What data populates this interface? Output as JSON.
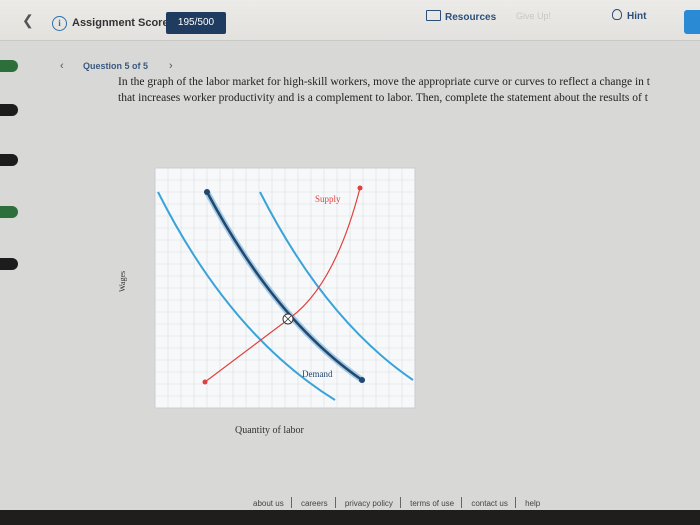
{
  "header": {
    "assignment_score_label": "Assignment Score:",
    "score_value": "195/500",
    "resources_label": "Resources",
    "give_up_label": "Give Up!",
    "hint_label": "Hint"
  },
  "question_nav": {
    "label": "Question 5 of 5"
  },
  "prompt": {
    "line1": "In the graph of the labor market for high-skill workers, move the appropriate curve or curves to reflect a change in t",
    "line2": "that increases worker productivity and is a complement to labor. Then, complete the statement about the results of t"
  },
  "graph": {
    "y_axis_label": "Wages",
    "x_axis_label": "Quantity of labor",
    "supply_label": "Supply",
    "demand_label": "Demand",
    "colors": {
      "supply": "#e0413f",
      "demand_original": "#2e6a9e",
      "demand_shifted": "#3aa3d8",
      "grid": "#d9dde3"
    }
  },
  "footer": {
    "links": [
      "about us",
      "careers",
      "privacy policy",
      "terms of use",
      "contact us",
      "help"
    ]
  }
}
